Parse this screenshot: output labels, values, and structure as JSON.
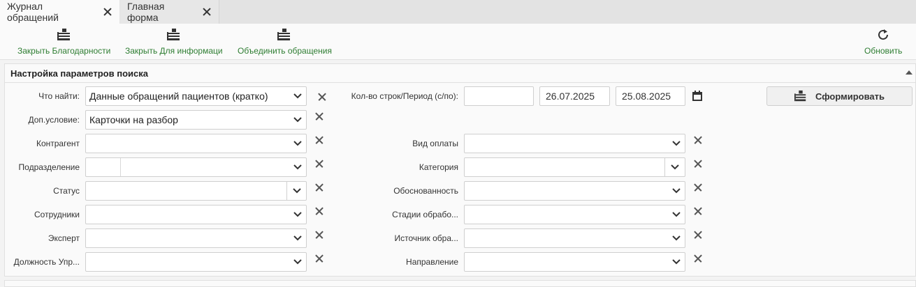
{
  "tabs": [
    {
      "label": "Журнал обращений",
      "active": true
    },
    {
      "label": "Главная форма",
      "active": false
    }
  ],
  "toolbar": {
    "close_thanks": "Закрыть Благодарности",
    "close_info": "Закрыть Для информаци",
    "merge": "Объединить обращения",
    "refresh": "Обновить",
    "accent_color": "#2e7d32"
  },
  "panel": {
    "title": "Настройка параметров поиска"
  },
  "form": {
    "what_label": "Что найти:",
    "what_value": "Данные обращений пациентов (кратко)",
    "extra_label": "Доп.условие:",
    "extra_value": "Карточки на разбор",
    "contractor_label": "Контрагент",
    "division_label": "Подразделение",
    "status_label": "Статус",
    "employees_label": "Сотрудники",
    "expert_label": "Эксперт",
    "position_label": "Должность Упр...",
    "rows_period_label": "Кол-во строк/Период (с/по):",
    "rows_value": "",
    "date_from": "26.07.2025",
    "date_to": "25.08.2025",
    "payment_label": "Вид оплаты",
    "category_label": "Категория",
    "validity_label": "Обоснованность",
    "stages_label": "Стадии обрабо...",
    "source_label": "Источник обра...",
    "direction_label": "Направление",
    "submit_label": "Сформировать"
  }
}
